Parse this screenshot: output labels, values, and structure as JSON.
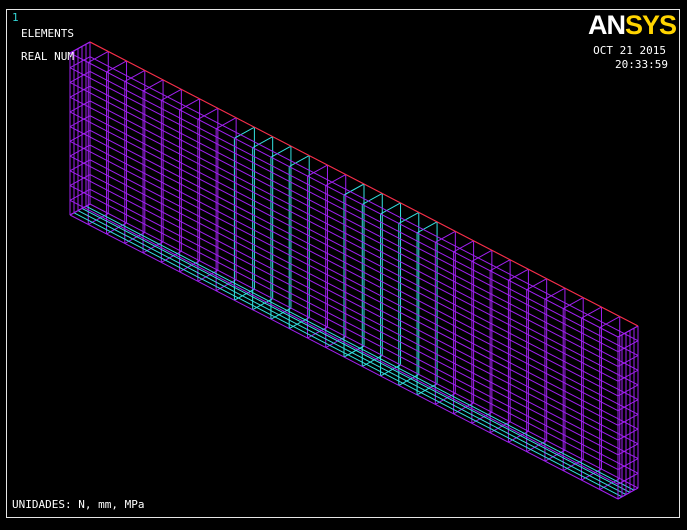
{
  "window": {
    "number": "1"
  },
  "labels": {
    "plot_type": "ELEMENTS",
    "display": "REAL NUM"
  },
  "logo": {
    "part1": "AN",
    "part2": "SYS"
  },
  "timestamp": {
    "date": "OCT 21 2015",
    "time": "20:33:59"
  },
  "units": "UNIDADES: N, mm, MPa",
  "colors": {
    "background": "#000000",
    "mesh_main": "#a020f0",
    "mesh_alt": "#33e0e0",
    "edge": "#ff3030",
    "logo_sys": "#ffd400"
  }
}
